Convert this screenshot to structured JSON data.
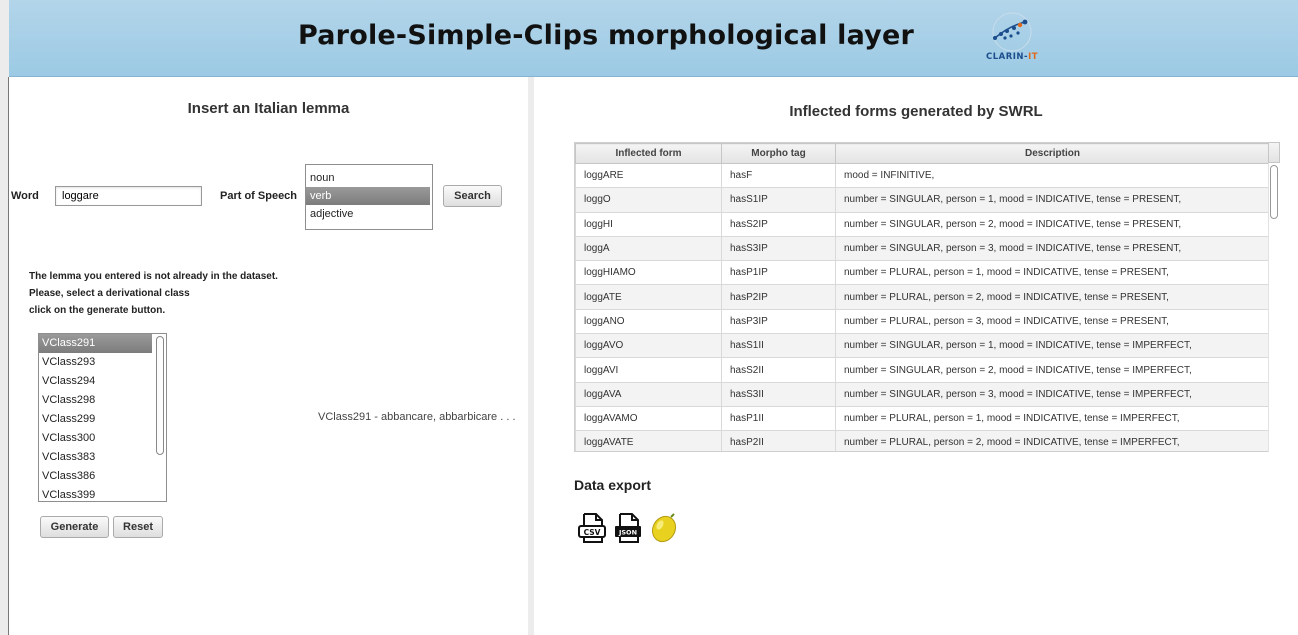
{
  "header": {
    "title": "Parole-Simple-Clips morphological layer",
    "logo_text_main": "CLARIN-",
    "logo_text_accent": "IT"
  },
  "left_panel": {
    "heading": "Insert an Italian lemma",
    "word_label": "Word",
    "word_value": "loggare",
    "pos_label": "Part of Speech",
    "pos_options": [
      "noun",
      "verb",
      "adjective"
    ],
    "pos_selected": "verb",
    "search_label": "Search",
    "message_lines": [
      "The lemma you entered is not already in the dataset.",
      "Please, select a derivational class",
      "click on the generate button."
    ],
    "classes": [
      "VClass291",
      "VClass293",
      "VClass294",
      "VClass298",
      "VClass299",
      "VClass300",
      "VClass383",
      "VClass386",
      "VClass399"
    ],
    "class_selected": "VClass291",
    "class_description": "VClass291 - abbancare, abbarbicare . . .",
    "generate_label": "Generate",
    "reset_label": "Reset"
  },
  "right_panel": {
    "heading": "Inflected forms generated by SWRL",
    "columns": [
      "Inflected form",
      "Morpho tag",
      "Description"
    ],
    "rows": [
      [
        "loggARE",
        "hasF",
        "mood = INFINITIVE,"
      ],
      [
        "loggO",
        "hasS1IP",
        "number = SINGULAR, person = 1, mood = INDICATIVE, tense = PRESENT,"
      ],
      [
        "loggHI",
        "hasS2IP",
        "number = SINGULAR, person = 2, mood = INDICATIVE, tense = PRESENT,"
      ],
      [
        "loggA",
        "hasS3IP",
        "number = SINGULAR, person = 3, mood = INDICATIVE, tense = PRESENT,"
      ],
      [
        "loggHIAMO",
        "hasP1IP",
        "number = PLURAL, person = 1, mood = INDICATIVE, tense = PRESENT,"
      ],
      [
        "loggATE",
        "hasP2IP",
        "number = PLURAL, person = 2, mood = INDICATIVE, tense = PRESENT,"
      ],
      [
        "loggANO",
        "hasP3IP",
        "number = PLURAL, person = 3, mood = INDICATIVE, tense = PRESENT,"
      ],
      [
        "loggAVO",
        "hasS1II",
        "number = SINGULAR, person = 1, mood = INDICATIVE, tense = IMPERFECT,"
      ],
      [
        "loggAVI",
        "hasS2II",
        "number = SINGULAR, person = 2, mood = INDICATIVE, tense = IMPERFECT,"
      ],
      [
        "loggAVA",
        "hasS3II",
        "number = SINGULAR, person = 3, mood = INDICATIVE, tense = IMPERFECT,"
      ],
      [
        "loggAVAMO",
        "hasP1II",
        "number = PLURAL, person = 1, mood = INDICATIVE, tense = IMPERFECT,"
      ],
      [
        "loggAVATE",
        "hasP2II",
        "number = PLURAL, person = 2, mood = INDICATIVE, tense = IMPERFECT,"
      ]
    ],
    "export_title": "Data export",
    "export_icons": [
      {
        "name": "csv-export-icon",
        "label": "CSV"
      },
      {
        "name": "json-export-icon",
        "label": "JSON"
      },
      {
        "name": "lemon-export-icon",
        "label": ""
      }
    ]
  },
  "colors": {
    "header_bg": "#a6cfe8",
    "selected_option": "#8a8a8a",
    "lemon": "#e8d21f"
  }
}
